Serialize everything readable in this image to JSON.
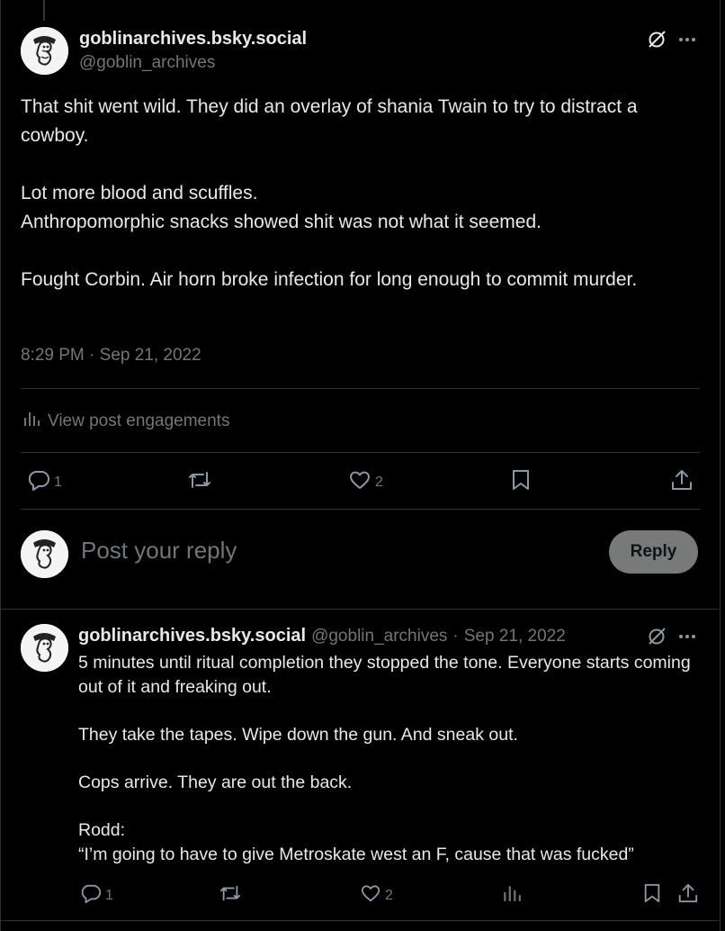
{
  "main_post": {
    "display_name": "goblinarchives.bsky.social",
    "handle": "@goblin_archives",
    "text": "That shit went wild. They did an overlay of shania Twain to try to distract a cowboy.\n\nLot more blood and scuffles.\nAnthropomorphic snacks showed shit was not what it seemed.\n\nFought Corbin. Air horn broke infection for long enough to commit murder.",
    "timestamp": "8:29 PM · Sep 21, 2022",
    "engagements_label": "View post engagements",
    "reply_count": "1",
    "retweet_count": "",
    "like_count": "2"
  },
  "composer": {
    "placeholder": "Post your reply",
    "reply_button": "Reply"
  },
  "reply_post": {
    "display_name": "goblinarchives.bsky.social",
    "handle": "@goblin_archives",
    "separator": "·",
    "date": "Sep 21, 2022",
    "text": "5 minutes until ritual completion they stopped the tone. Everyone starts coming out of it and freaking out.\n\nThey take the tapes. Wipe down the gun. And sneak out.\n\nCops arrive. They are out the back.\n\nRodd:\n“I’m going to have to give Metroskate west an F, cause that was fucked”",
    "reply_count": "1",
    "like_count": "2"
  },
  "icons": {
    "grok": "slashed-circle-icon",
    "more": "more-dots-icon",
    "analytics": "bar-chart-icon",
    "reply": "speech-bubble-icon",
    "retweet": "retweet-icon",
    "like": "heart-icon",
    "bookmark": "bookmark-icon",
    "share": "share-upload-icon"
  }
}
